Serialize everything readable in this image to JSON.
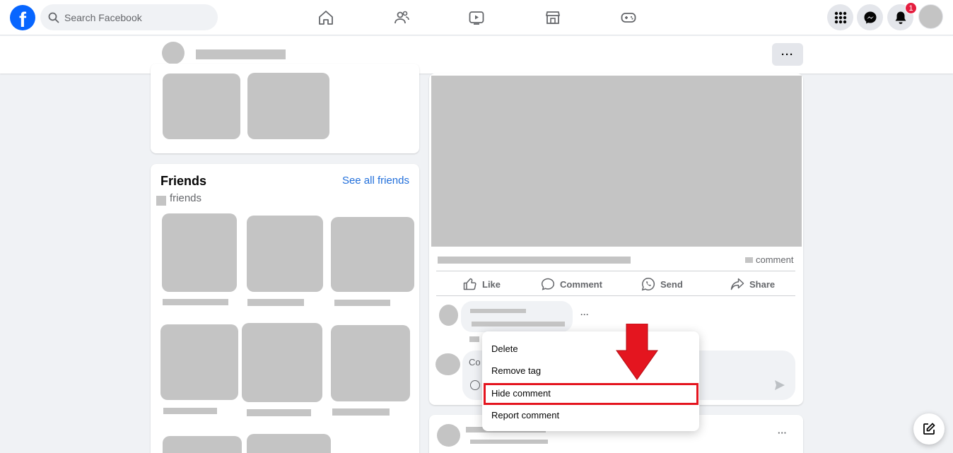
{
  "topnav": {
    "logo_letter": "f",
    "search_placeholder": "Search Facebook",
    "nav_icons": [
      "home-icon",
      "friends-icon",
      "watch-icon",
      "marketplace-icon",
      "gaming-icon"
    ],
    "notification_count": "1",
    "brand_color": "#0866ff"
  },
  "profile_header": {
    "more_label": "···"
  },
  "friends": {
    "title": "Friends",
    "see_all": "See all friends",
    "count_label": "friends"
  },
  "post": {
    "comment_count_label": "comment",
    "actions": [
      "Like",
      "Comment",
      "Send",
      "Share"
    ],
    "comment_more": "···",
    "comment_input_partial": "Co"
  },
  "context_menu": {
    "items": [
      "Delete",
      "Remove tag",
      "Hide comment",
      "Report comment"
    ],
    "highlighted": "Hide comment",
    "highlight_color": "#e4151f"
  },
  "next_post": {
    "more_label": "···"
  }
}
